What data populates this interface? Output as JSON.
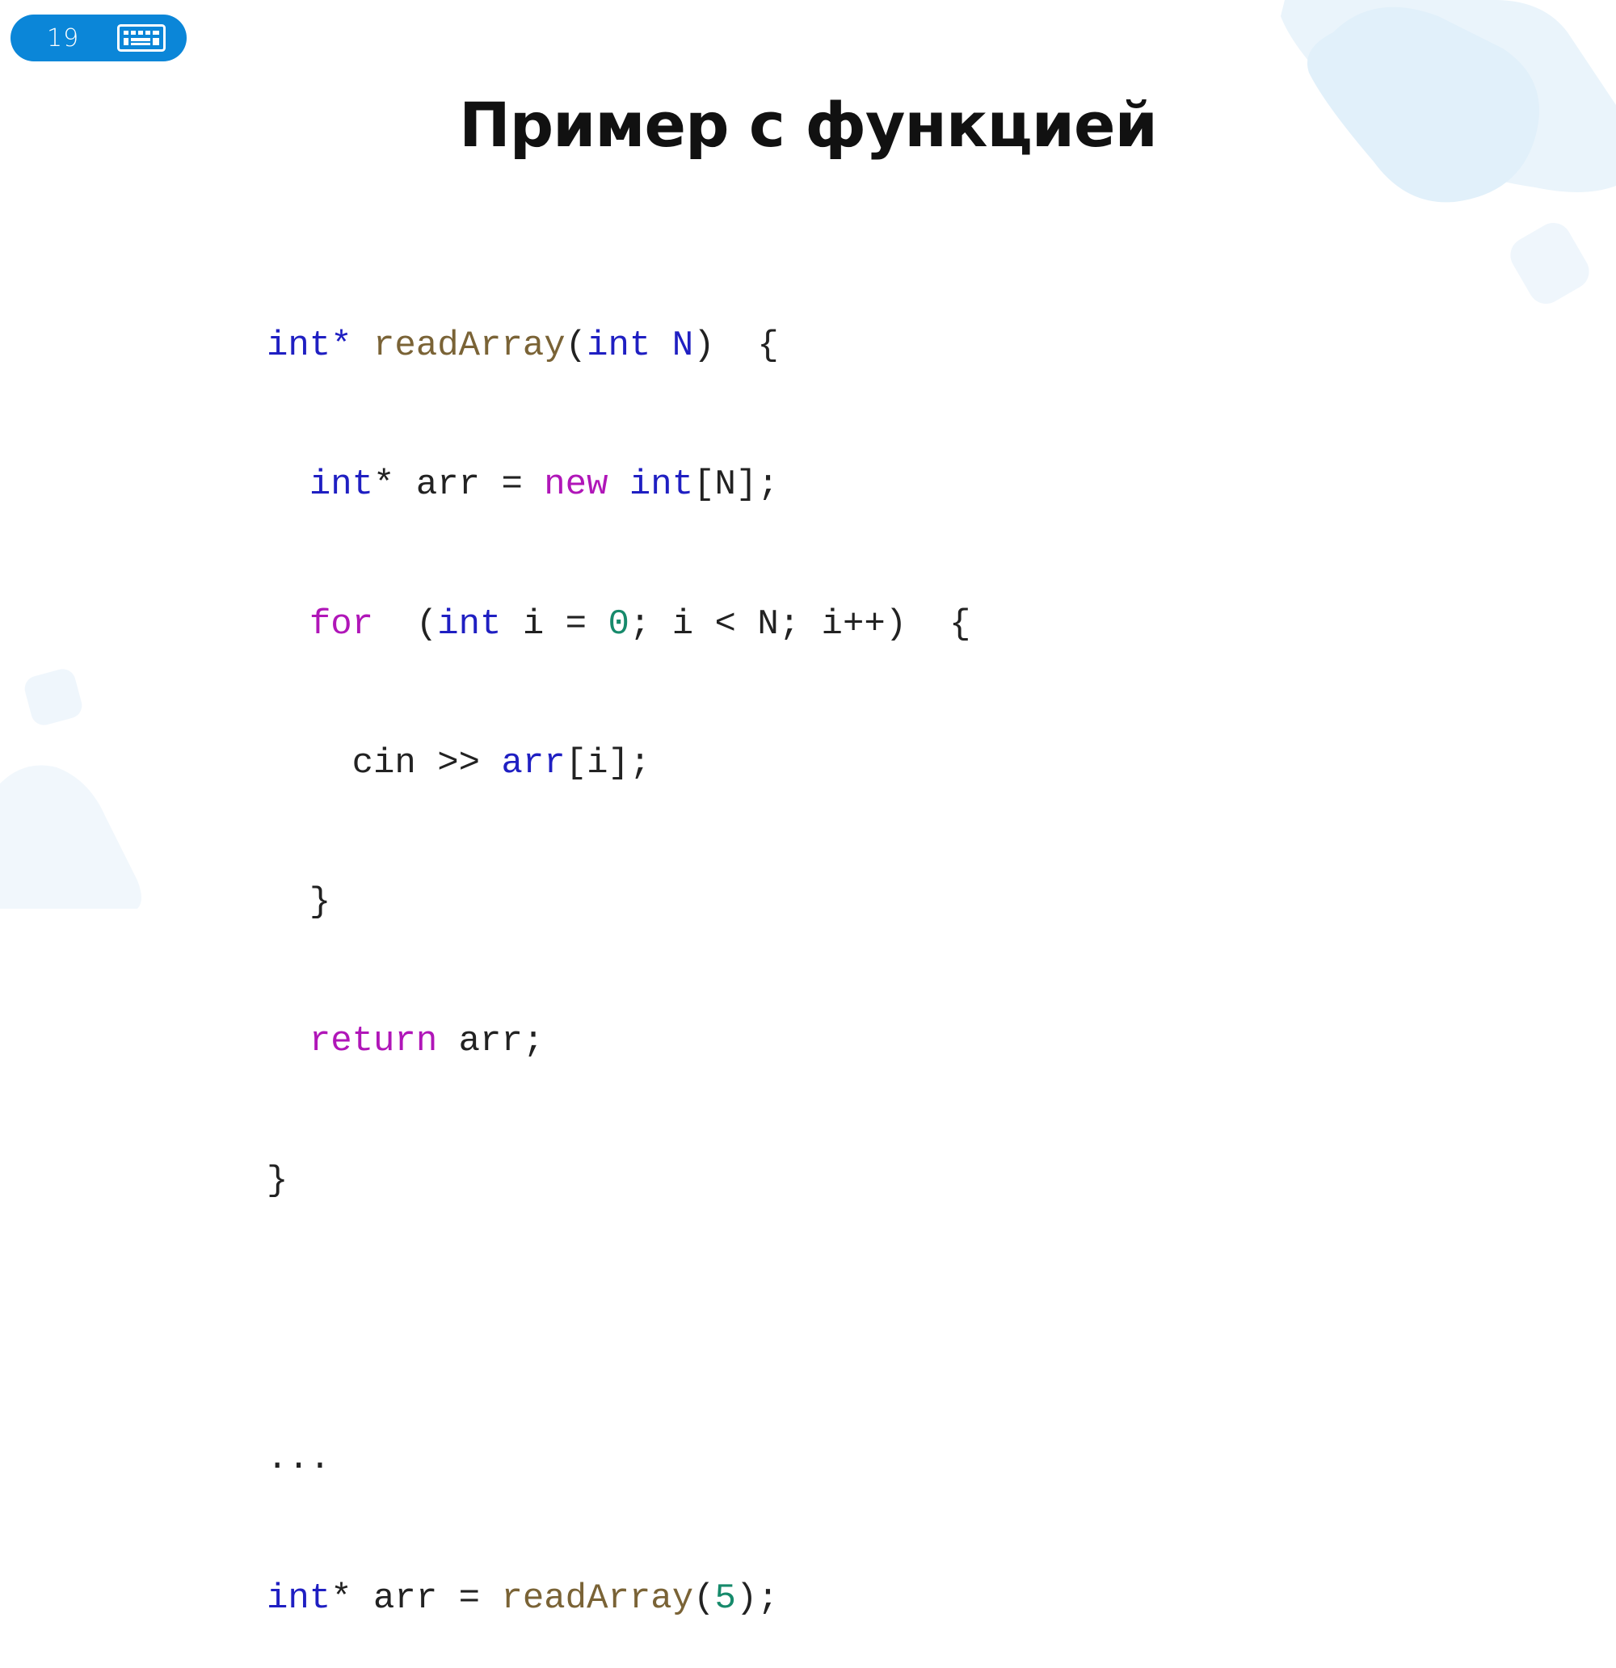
{
  "slide": {
    "number": "19",
    "title": "Пример с функцией"
  },
  "icons": {
    "badge_icon": "keyboard-icon"
  },
  "colors": {
    "badge": "#0b86d8",
    "type_keyword": "#1f1fc2",
    "control_keyword": "#b016b8",
    "function_name": "#7a6336",
    "number_literal": "#168a6b"
  },
  "code": {
    "l1": {
      "t1": "int*",
      "t2": " ",
      "t3": "readArray",
      "t4": "(",
      "t5": "int",
      "t6": " ",
      "t7": "N",
      "t8": ")  {"
    },
    "l2": {
      "i": "  ",
      "t1": "int",
      "t2": "* arr = ",
      "t3": "new",
      "t4": " ",
      "t5": "int",
      "t6": "[N];"
    },
    "l3": {
      "i": "  ",
      "t1": "for",
      "t2": "  (",
      "t3": "int",
      "t4": " i = ",
      "t5": "0",
      "t6": "; i < N; i++)  {"
    },
    "l4": {
      "i": "    ",
      "t1": "cin >> ",
      "t2": "arr",
      "t3": "[i];"
    },
    "l5": {
      "i": "  ",
      "t1": "}"
    },
    "l6": {
      "i": "  ",
      "t1": "return",
      "t2": " arr;"
    },
    "l7": {
      "t1": "}"
    },
    "l8": {
      "t1": ""
    },
    "l9": {
      "t1": "..."
    },
    "l10": {
      "t1": "int",
      "t2": "* arr = ",
      "t3": "readArray",
      "t4": "(",
      "t5": "5",
      "t6": ");"
    }
  }
}
